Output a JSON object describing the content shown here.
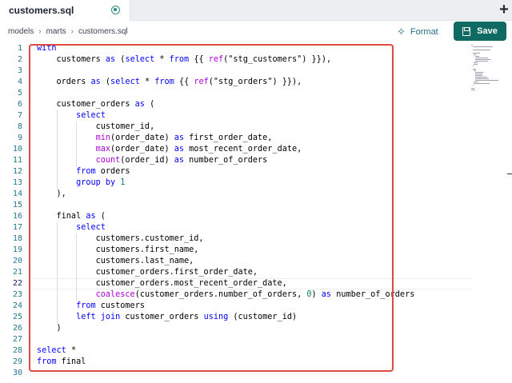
{
  "tab": {
    "title": "customers.sql"
  },
  "breadcrumb": [
    "models",
    "marts",
    "customers.sql"
  ],
  "toolbar": {
    "format_label": "Format",
    "save_label": "Save"
  },
  "editor": {
    "active_line": 22,
    "lines": [
      [
        {
          "t": "with",
          "c": "kw"
        }
      ],
      [
        {
          "t": "    customers "
        },
        {
          "t": "as",
          "c": "kw"
        },
        {
          "t": " ("
        },
        {
          "t": "select",
          "c": "kw"
        },
        {
          "t": " * "
        },
        {
          "t": "from",
          "c": "kw"
        },
        {
          "t": " {{ "
        },
        {
          "t": "ref",
          "c": "fnp"
        },
        {
          "t": "(\"stg_customers\") }}),"
        }
      ],
      [
        {
          "t": ""
        }
      ],
      [
        {
          "t": "    orders "
        },
        {
          "t": "as",
          "c": "kw"
        },
        {
          "t": " ("
        },
        {
          "t": "select",
          "c": "kw"
        },
        {
          "t": " * "
        },
        {
          "t": "from",
          "c": "kw"
        },
        {
          "t": " {{ "
        },
        {
          "t": "ref",
          "c": "fnp"
        },
        {
          "t": "(\"stg_orders\") }}),"
        }
      ],
      [
        {
          "t": ""
        }
      ],
      [
        {
          "t": "    customer_orders "
        },
        {
          "t": "as",
          "c": "kw"
        },
        {
          "t": " ("
        }
      ],
      [
        {
          "t": "        "
        },
        {
          "t": "select",
          "c": "kw"
        }
      ],
      [
        {
          "t": "            customer_id,"
        }
      ],
      [
        {
          "t": "            "
        },
        {
          "t": "min",
          "c": "fnp"
        },
        {
          "t": "(order_date) "
        },
        {
          "t": "as",
          "c": "kw"
        },
        {
          "t": " first_order_date,"
        }
      ],
      [
        {
          "t": "            "
        },
        {
          "t": "max",
          "c": "fnp"
        },
        {
          "t": "(order_date) "
        },
        {
          "t": "as",
          "c": "kw"
        },
        {
          "t": " most_recent_order_date,"
        }
      ],
      [
        {
          "t": "            "
        },
        {
          "t": "count",
          "c": "fnp"
        },
        {
          "t": "(order_id) "
        },
        {
          "t": "as",
          "c": "kw"
        },
        {
          "t": " number_of_orders"
        }
      ],
      [
        {
          "t": "        "
        },
        {
          "t": "from",
          "c": "kw"
        },
        {
          "t": " orders"
        }
      ],
      [
        {
          "t": "        "
        },
        {
          "t": "group by",
          "c": "kw"
        },
        {
          "t": " "
        },
        {
          "t": "1",
          "c": "num"
        }
      ],
      [
        {
          "t": "    ),"
        }
      ],
      [
        {
          "t": ""
        }
      ],
      [
        {
          "t": "    final "
        },
        {
          "t": "as",
          "c": "kw"
        },
        {
          "t": " ("
        }
      ],
      [
        {
          "t": "        "
        },
        {
          "t": "select",
          "c": "kw"
        }
      ],
      [
        {
          "t": "            customers.customer_id,"
        }
      ],
      [
        {
          "t": "            customers.first_name,"
        }
      ],
      [
        {
          "t": "            customers.last_name,"
        }
      ],
      [
        {
          "t": "            customer_orders.first_order_date,"
        }
      ],
      [
        {
          "t": "            customer_orders.most_recent_order_date,"
        }
      ],
      [
        {
          "t": "            "
        },
        {
          "t": "coalesce",
          "c": "fnp"
        },
        {
          "t": "(customer_orders.number_of_orders, "
        },
        {
          "t": "0",
          "c": "num"
        },
        {
          "t": ") "
        },
        {
          "t": "as",
          "c": "kw"
        },
        {
          "t": " number_of_orders"
        }
      ],
      [
        {
          "t": "        "
        },
        {
          "t": "from",
          "c": "kw"
        },
        {
          "t": " customers"
        }
      ],
      [
        {
          "t": "        "
        },
        {
          "t": "left join",
          "c": "kw"
        },
        {
          "t": " customer_orders "
        },
        {
          "t": "using",
          "c": "kw"
        },
        {
          "t": " (customer_id)"
        }
      ],
      [
        {
          "t": "    )"
        }
      ],
      [
        {
          "t": ""
        }
      ],
      [
        {
          "t": "select",
          "c": "kw"
        },
        {
          "t": " *"
        }
      ],
      [
        {
          "t": "from",
          "c": "kw"
        },
        {
          "t": " final"
        }
      ],
      [
        {
          "t": ""
        }
      ]
    ]
  }
}
